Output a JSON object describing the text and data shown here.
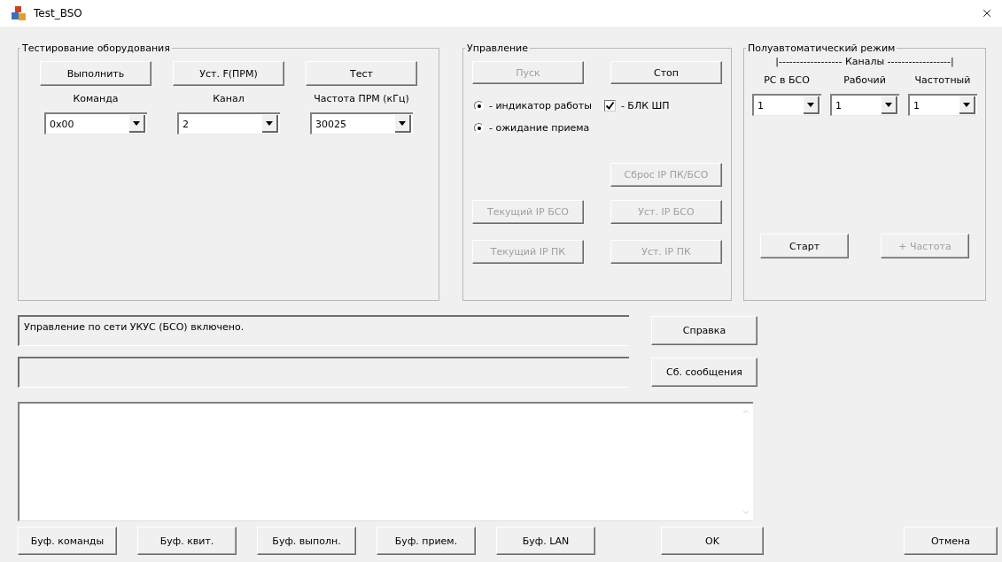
{
  "window": {
    "title": "Test_BSO"
  },
  "testing_group": {
    "title": "Тестирование оборудования",
    "buttons": [
      {
        "label": "Выполнить",
        "disabled": false
      },
      {
        "label": "Уст. F(ПРМ)",
        "disabled": false
      },
      {
        "label": "Тест",
        "disabled": false
      }
    ],
    "fields": [
      {
        "label": "Команда",
        "value": "0x00"
      },
      {
        "label": "Канал",
        "value": "2"
      },
      {
        "label": "Частота ПРМ (кГц)",
        "value": "30025"
      }
    ]
  },
  "control_group": {
    "title": "Управление",
    "buttons": [
      {
        "label": "Пуск",
        "disabled": true
      },
      {
        "label": "Стоп",
        "disabled": false
      }
    ],
    "radios": [
      {
        "label": "- индикатор работы",
        "selected": true
      },
      {
        "label": "- ожидание приема",
        "selected": true
      }
    ],
    "checkbox": {
      "label": "- БЛК ШП",
      "checked": true
    },
    "ip_buttons": [
      {
        "label": "Сброс IP ПК/БСО",
        "disabled": true
      },
      {
        "label": "Текущий IP БСО",
        "disabled": true
      },
      {
        "label": "Уст. IP БСО",
        "disabled": true
      },
      {
        "label": "Текущий IP ПК",
        "disabled": true
      },
      {
        "label": "Уст. IP ПК",
        "disabled": true
      }
    ]
  },
  "semi_auto_group": {
    "title": "Полуавтоматический режим",
    "header": "|------------------  Каналы  ------------------|",
    "fields": [
      {
        "label": "РС в БСО",
        "value": "1"
      },
      {
        "label": "Рабочий",
        "value": "1"
      },
      {
        "label": "Частотный",
        "value": "1"
      }
    ],
    "buttons": [
      {
        "label": "Старт",
        "disabled": false
      },
      {
        "label": "+ Частота",
        "disabled": true
      }
    ]
  },
  "status_rows": [
    {
      "value": "Управление по сети УКУС (БСО) включено.",
      "button": "Справка"
    },
    {
      "value": "",
      "button": "Сб. сообщения"
    }
  ],
  "bottom_buttons": [
    {
      "label": "Буф. команды"
    },
    {
      "label": "Буф. квит."
    },
    {
      "label": "Буф. выполн."
    },
    {
      "label": "Буф. прием."
    },
    {
      "label": "Буф. LAN"
    }
  ],
  "ok_button": "OK",
  "cancel_button": "Отмена"
}
